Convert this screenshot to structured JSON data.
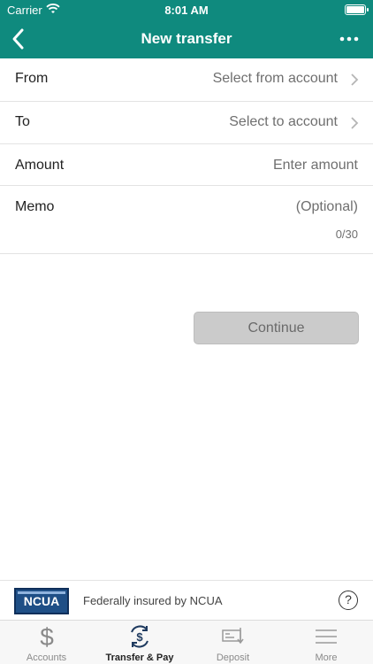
{
  "status_bar": {
    "carrier": "Carrier",
    "time": "8:01 AM"
  },
  "nav": {
    "title": "New transfer",
    "back_icon": "chevron-left-icon",
    "more_icon": "more-horizontal-icon"
  },
  "form": {
    "from": {
      "label": "From",
      "value": "Select from account"
    },
    "to": {
      "label": "To",
      "value": "Select to account"
    },
    "amount": {
      "label": "Amount",
      "placeholder": "Enter amount"
    },
    "memo": {
      "label": "Memo",
      "placeholder": "(Optional)",
      "counter": "0/30"
    }
  },
  "continue_label": "Continue",
  "insured": {
    "logo_text": "NCUA",
    "text": "Federally insured by NCUA",
    "help": "?"
  },
  "tabs": [
    {
      "label": "Accounts",
      "icon": "dollar-icon"
    },
    {
      "label": "Transfer & Pay",
      "icon": "transfer-icon",
      "active": true
    },
    {
      "label": "Deposit",
      "icon": "deposit-check-icon"
    },
    {
      "label": "More",
      "icon": "menu-icon"
    }
  ],
  "colors": {
    "header": "#0f8a7e",
    "button_disabled": "#cbcbcb"
  }
}
